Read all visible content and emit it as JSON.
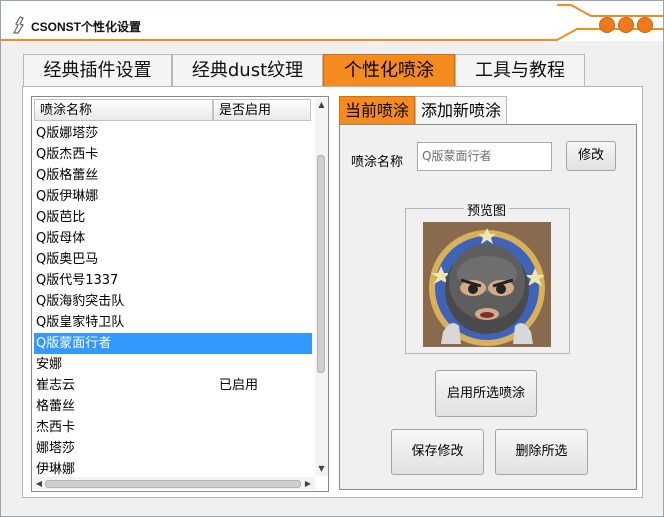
{
  "window": {
    "title": "CSONST个性化设置",
    "accent_color": "#f58b1f",
    "selection_color": "#3399ff",
    "controls": [
      "minimize-icon",
      "maximize-icon",
      "close-icon"
    ]
  },
  "main_tabs": [
    {
      "label": "经典插件设置",
      "active": false
    },
    {
      "label": "经典dust纹理",
      "active": false
    },
    {
      "label": "个性化喷涂",
      "active": true
    },
    {
      "label": "工具与教程",
      "active": false
    }
  ],
  "spray_list": {
    "columns": [
      "喷涂名称",
      "是否启用"
    ],
    "rows": [
      {
        "name": "Q版娜塔莎",
        "status": ""
      },
      {
        "name": "Q版杰西卡",
        "status": ""
      },
      {
        "name": "Q版格蕾丝",
        "status": ""
      },
      {
        "name": "Q版伊琳娜",
        "status": ""
      },
      {
        "name": "Q版芭比",
        "status": ""
      },
      {
        "name": "Q版母体",
        "status": ""
      },
      {
        "name": "Q版奥巴马",
        "status": ""
      },
      {
        "name": "Q版代号1337",
        "status": ""
      },
      {
        "name": "Q版海豹突击队",
        "status": ""
      },
      {
        "name": "Q版皇家特卫队",
        "status": ""
      },
      {
        "name": "Q版蒙面行者",
        "status": "",
        "selected": true
      },
      {
        "name": "安娜",
        "status": ""
      },
      {
        "name": "崔志云",
        "status": "已启用"
      },
      {
        "name": "格蕾丝",
        "status": ""
      },
      {
        "name": "杰西卡",
        "status": ""
      },
      {
        "name": "娜塔莎",
        "status": ""
      },
      {
        "name": "伊琳娜",
        "status": ""
      }
    ]
  },
  "sub_tabs": [
    {
      "label": "当前喷涂",
      "active": true
    },
    {
      "label": "添加新喷涂",
      "active": false
    }
  ],
  "current_spray": {
    "name_label": "喷涂名称",
    "name_value": "Q版蒙面行者",
    "modify_button": "修改",
    "preview_title": "预览图",
    "enable_button": "启用所选喷涂",
    "save_button": "保存修改",
    "delete_button": "删除所选"
  }
}
